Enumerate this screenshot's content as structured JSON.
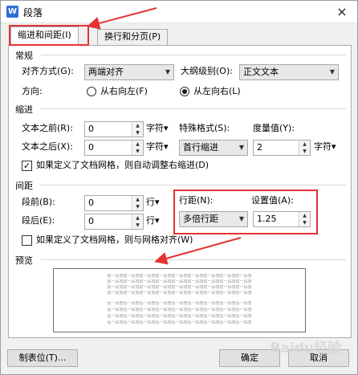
{
  "window": {
    "title": "段落",
    "app_icon": "W",
    "close": "×"
  },
  "tabs": [
    {
      "label": "缩进和间距(I)",
      "active": true
    },
    {
      "label": "换行和分页(P)",
      "active": false
    }
  ],
  "general": {
    "title": "常规",
    "alignment_label": "对齐方式(G):",
    "alignment_value": "两端对齐",
    "outline_label": "大纲级别(O):",
    "outline_value": "正文文本",
    "direction_label": "方向:",
    "rtl_label": "从右向左(F)",
    "ltr_label": "从左向右(L)"
  },
  "indent": {
    "title": "缩进",
    "before_label": "文本之前(R):",
    "before_value": "0",
    "before_unit": "字符▾",
    "after_label": "文本之后(X):",
    "after_value": "0",
    "after_unit": "字符▾",
    "special_label": "特殊格式(S):",
    "special_value": "首行缩进",
    "measure_label": "度量值(Y):",
    "measure_value": "2",
    "measure_unit": "字符▾",
    "grid_check_label": "如果定义了文档网格，则自动调整右缩进(D)",
    "grid_checked": true
  },
  "spacing": {
    "title": "间距",
    "before_label": "段前(B):",
    "before_value": "0",
    "before_unit": "行▾",
    "after_label": "段后(E):",
    "after_value": "0",
    "after_unit": "行▾",
    "line_label": "行距(N):",
    "line_value": "多倍行距",
    "setting_label": "设置值(A):",
    "setting_value": "1.25",
    "grid_check_label": "如果定义了文档网格，则与网格对齐(W)",
    "grid_checked": false
  },
  "preview": {
    "title": "预览",
    "prev_text": "前一段落前一段落前一段落前一段落前一段落前一段落前一段落前一段落前一段落",
    "sample_text": "示例文字示例文字示例文字示例文字示例文字示例文字示例文字示例文字示例文字",
    "next_text": "后一段落后一段落后一段落后一段落后一段落后一段落后一段落后一段落后一段落"
  },
  "buttons": {
    "tabs_label": "制表位(T)...",
    "ok_label": "确定",
    "cancel_label": "取消"
  },
  "watermark": "Baidu经验",
  "colors": {
    "annotation": "#e63232",
    "app_icon": "#2c6fd6"
  }
}
